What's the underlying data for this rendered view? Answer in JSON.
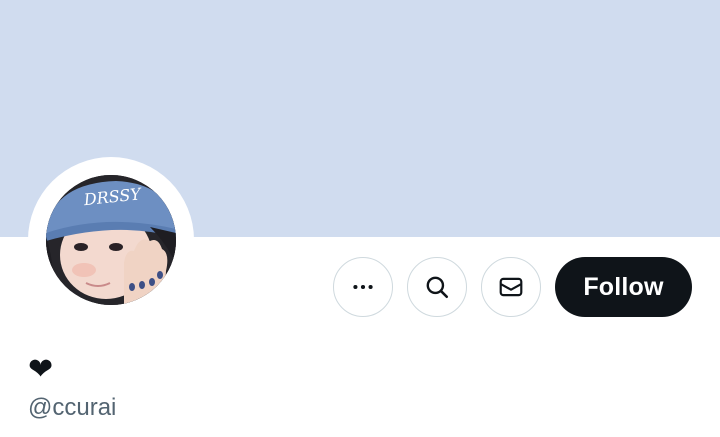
{
  "profile": {
    "display_name": "❤",
    "handle": "@ccurai",
    "avatar_cap_text": "DRSSY"
  },
  "actions": {
    "more_label": "More",
    "search_label": "Search",
    "message_label": "Message",
    "follow_label": "Follow"
  },
  "colors": {
    "banner": "#d0dcef",
    "follow_bg": "#0f1419",
    "follow_text": "#ffffff",
    "handle_text": "#536471",
    "button_border": "#cfd9de"
  },
  "icons": {
    "more": "more-dots-icon",
    "search": "search-icon",
    "message": "envelope-icon",
    "avatar": "profile-photo"
  }
}
